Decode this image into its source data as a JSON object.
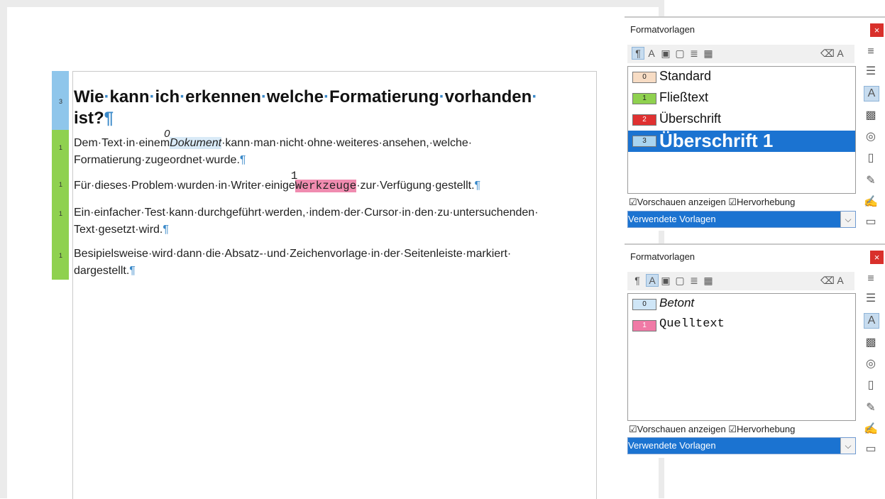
{
  "document": {
    "heading": {
      "level": "3",
      "text1": "Wie",
      "text2": "kann",
      "text3": "ich",
      "text4": "erkennen",
      "text5": "welche",
      "text6": "Formatierung",
      "text7": "vorhanden",
      "text8": "ist?"
    },
    "p1": {
      "level": "1",
      "before": "Dem·Text·in·einem",
      "marker": "0",
      "em": "Dokument",
      "after": "·kann·man·nicht·ohne·weiteres·ansehen,·welche·",
      "line2": "Formatierung·zugeordnet·wurde."
    },
    "p2": {
      "level": "1",
      "before": "Für·dieses·Problem·wurden·in·Writer·einige",
      "marker": "1",
      "code": "Werkzeuge",
      "after": "·zur·Verfügung·gestellt."
    },
    "p3": {
      "level": "1",
      "line1": "Ein·einfacher·Test·kann·durchgeführt·werden,·indem·der·Cursor·in·den·zu·untersuchenden·",
      "line2": "Text·gesetzt·wird."
    },
    "p4": {
      "level": "1",
      "line1": "Besipielsweise·wird·dann·die·Absatz-·und·Zeichenvorlage·in·der·Seitenleiste·markiert·",
      "line2": "dargestellt."
    },
    "pilcrow": "¶"
  },
  "panel1": {
    "title": "Formatvorlagen",
    "close": "×",
    "items": [
      {
        "num": "0",
        "label": "Standard",
        "color": "#f7dcc4"
      },
      {
        "num": "1",
        "label": "Fließtext",
        "color": "#8fd14f"
      },
      {
        "num": "2",
        "label": "Überschrift",
        "color": "#e03131"
      },
      {
        "num": "3",
        "label": "Überschrift 1",
        "color": "#a9d4f0"
      }
    ],
    "check_preview": "Vorschauen anzeigen",
    "check_highlight": "Hervorhebung",
    "filter": "Verwendete Vorlagen"
  },
  "panel2": {
    "title": "Formatvorlagen",
    "close": "×",
    "items": [
      {
        "num": "0",
        "label": "Betont",
        "color": "#cfe6f7"
      },
      {
        "num": "1",
        "label": "Quelltext",
        "color": "#f07aa6"
      }
    ],
    "check_preview": "Vorschauen anzeigen",
    "check_highlight": "Hervorhebung",
    "filter": "Verwendete Vorlagen"
  },
  "icons": {
    "menu": "≡",
    "dropdown_arrow": "⌵",
    "checkbox": "☑"
  }
}
